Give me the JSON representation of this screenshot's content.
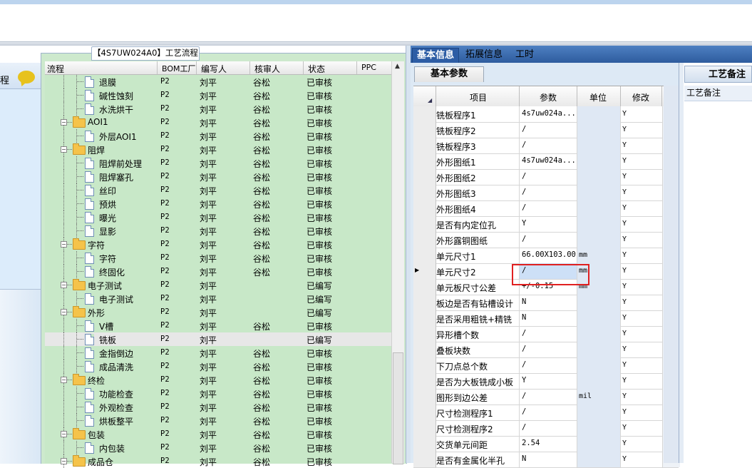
{
  "left": {
    "label": "程"
  },
  "tree": {
    "tab_title": "【4S7UW024A0】工艺流程",
    "columns": [
      "流程",
      "BOM工厂",
      "编写人",
      "核审人",
      "状态",
      "PPC"
    ],
    "rows": [
      {
        "name": "退膜",
        "level": 2,
        "folder": false,
        "bom": "P2",
        "writer": "刘平",
        "reviewer": "谷松",
        "status": "已审核"
      },
      {
        "name": "碱性蚀刻",
        "level": 2,
        "folder": false,
        "bom": "P2",
        "writer": "刘平",
        "reviewer": "谷松",
        "status": "已审核"
      },
      {
        "name": "水洗烘干",
        "level": 2,
        "folder": false,
        "bom": "P2",
        "writer": "刘平",
        "reviewer": "谷松",
        "status": "已审核"
      },
      {
        "name": "AOI1",
        "level": 1,
        "folder": true,
        "bom": "P2",
        "writer": "刘平",
        "reviewer": "谷松",
        "status": "已审核"
      },
      {
        "name": "外层AOI1",
        "level": 2,
        "folder": false,
        "bom": "P2",
        "writer": "刘平",
        "reviewer": "谷松",
        "status": "已审核"
      },
      {
        "name": "阻焊",
        "level": 1,
        "folder": true,
        "bom": "P2",
        "writer": "刘平",
        "reviewer": "谷松",
        "status": "已审核"
      },
      {
        "name": "阻焊前处理",
        "level": 2,
        "folder": false,
        "bom": "P2",
        "writer": "刘平",
        "reviewer": "谷松",
        "status": "已审核"
      },
      {
        "name": "阻焊塞孔",
        "level": 2,
        "folder": false,
        "bom": "P2",
        "writer": "刘平",
        "reviewer": "谷松",
        "status": "已审核"
      },
      {
        "name": "丝印",
        "level": 2,
        "folder": false,
        "bom": "P2",
        "writer": "刘平",
        "reviewer": "谷松",
        "status": "已审核"
      },
      {
        "name": "预烘",
        "level": 2,
        "folder": false,
        "bom": "P2",
        "writer": "刘平",
        "reviewer": "谷松",
        "status": "已审核"
      },
      {
        "name": "曝光",
        "level": 2,
        "folder": false,
        "bom": "P2",
        "writer": "刘平",
        "reviewer": "谷松",
        "status": "已审核"
      },
      {
        "name": "显影",
        "level": 2,
        "folder": false,
        "bom": "P2",
        "writer": "刘平",
        "reviewer": "谷松",
        "status": "已审核"
      },
      {
        "name": "字符",
        "level": 1,
        "folder": true,
        "bom": "P2",
        "writer": "刘平",
        "reviewer": "谷松",
        "status": "已审核"
      },
      {
        "name": "字符",
        "level": 2,
        "folder": false,
        "bom": "P2",
        "writer": "刘平",
        "reviewer": "谷松",
        "status": "已审核"
      },
      {
        "name": "终固化",
        "level": 2,
        "folder": false,
        "bom": "P2",
        "writer": "刘平",
        "reviewer": "谷松",
        "status": "已审核"
      },
      {
        "name": "电子测试",
        "level": 1,
        "folder": true,
        "bom": "P2",
        "writer": "刘平",
        "reviewer": "",
        "status": "已编写"
      },
      {
        "name": "电子测试",
        "level": 2,
        "folder": false,
        "bom": "P2",
        "writer": "刘平",
        "reviewer": "",
        "status": "已编写"
      },
      {
        "name": "外形",
        "level": 1,
        "folder": true,
        "bom": "P2",
        "writer": "刘平",
        "reviewer": "",
        "status": "已编写"
      },
      {
        "name": "V槽",
        "level": 2,
        "folder": false,
        "bom": "P2",
        "writer": "刘平",
        "reviewer": "谷松",
        "status": "已审核"
      },
      {
        "name": "铣板",
        "level": 2,
        "folder": false,
        "bom": "P2",
        "writer": "刘平",
        "reviewer": "",
        "status": "已编写",
        "selected": true
      },
      {
        "name": "金指倒边",
        "level": 2,
        "folder": false,
        "bom": "P2",
        "writer": "刘平",
        "reviewer": "谷松",
        "status": "已审核"
      },
      {
        "name": "成品清洗",
        "level": 2,
        "folder": false,
        "bom": "P2",
        "writer": "刘平",
        "reviewer": "谷松",
        "status": "已审核"
      },
      {
        "name": "终检",
        "level": 1,
        "folder": true,
        "bom": "P2",
        "writer": "刘平",
        "reviewer": "谷松",
        "status": "已审核"
      },
      {
        "name": "功能检查",
        "level": 2,
        "folder": false,
        "bom": "P2",
        "writer": "刘平",
        "reviewer": "谷松",
        "status": "已审核"
      },
      {
        "name": "外观检查",
        "level": 2,
        "folder": false,
        "bom": "P2",
        "writer": "刘平",
        "reviewer": "谷松",
        "status": "已审核"
      },
      {
        "name": "烘板整平",
        "level": 2,
        "folder": false,
        "bom": "P2",
        "writer": "刘平",
        "reviewer": "谷松",
        "status": "已审核"
      },
      {
        "name": "包装",
        "level": 1,
        "folder": true,
        "bom": "P2",
        "writer": "刘平",
        "reviewer": "谷松",
        "status": "已审核"
      },
      {
        "name": "内包装",
        "level": 2,
        "folder": false,
        "bom": "P2",
        "writer": "刘平",
        "reviewer": "谷松",
        "status": "已审核"
      },
      {
        "name": "成品仓",
        "level": 1,
        "folder": true,
        "bom": "P2",
        "writer": "刘平",
        "reviewer": "谷松",
        "status": "已审核"
      }
    ]
  },
  "right": {
    "tabs": [
      "基本信息",
      "拓展信息",
      "工时"
    ],
    "active_tab": 0,
    "subtab": "基本参数",
    "grid_columns": [
      "项目",
      "参数",
      "单位",
      "修改"
    ],
    "grid_rows": [
      {
        "item": "铣板程序1",
        "param": "4s7uw024a...",
        "unit": "",
        "mod": "Y"
      },
      {
        "item": "铣板程序2",
        "param": "/",
        "unit": "",
        "mod": "Y"
      },
      {
        "item": "铣板程序3",
        "param": "/",
        "unit": "",
        "mod": "Y"
      },
      {
        "item": "外形图纸1",
        "param": "4s7uw024a...",
        "unit": "",
        "mod": "Y"
      },
      {
        "item": "外形图纸2",
        "param": "/",
        "unit": "",
        "mod": "Y"
      },
      {
        "item": "外形图纸3",
        "param": "/",
        "unit": "",
        "mod": "Y"
      },
      {
        "item": "外形图纸4",
        "param": "/",
        "unit": "",
        "mod": "Y"
      },
      {
        "item": "是否有内定位孔",
        "param": "Y",
        "unit": "",
        "mod": "Y"
      },
      {
        "item": "外形露铜图纸",
        "param": "/",
        "unit": "",
        "mod": "Y"
      },
      {
        "item": "单元尺寸1",
        "param": "66.00X103.00",
        "unit": "mm",
        "mod": "Y"
      },
      {
        "item": "单元尺寸2",
        "param": "/",
        "unit": "mm",
        "mod": "Y",
        "current": true
      },
      {
        "item": "单元板尺寸公差",
        "param": "+/-0.15",
        "unit": "mm",
        "mod": "Y"
      },
      {
        "item": "板边是否有钻槽设计",
        "param": "N",
        "unit": "",
        "mod": "Y"
      },
      {
        "item": "是否采用粗铣+精铣",
        "param": "N",
        "unit": "",
        "mod": "Y"
      },
      {
        "item": "异形槽个数",
        "param": "/",
        "unit": "",
        "mod": "Y"
      },
      {
        "item": "叠板块数",
        "param": "/",
        "unit": "",
        "mod": "Y"
      },
      {
        "item": "下刀点总个数",
        "param": "/",
        "unit": "",
        "mod": "Y"
      },
      {
        "item": "是否为大板铣成小板",
        "param": "Y",
        "unit": "",
        "mod": "Y"
      },
      {
        "item": "图形到边公差",
        "param": "/",
        "unit": "mil",
        "mod": "Y"
      },
      {
        "item": "尺寸检测程序1",
        "param": "/",
        "unit": "",
        "mod": "Y"
      },
      {
        "item": "尺寸检测程序2",
        "param": "/",
        "unit": "",
        "mod": "Y"
      },
      {
        "item": "交货单元间距",
        "param": "2.54",
        "unit": "",
        "mod": "Y"
      },
      {
        "item": "是否有金属化半孔",
        "param": "N",
        "unit": "",
        "mod": "Y"
      }
    ],
    "side_title": "工艺备注",
    "side_label": "工艺备注"
  }
}
